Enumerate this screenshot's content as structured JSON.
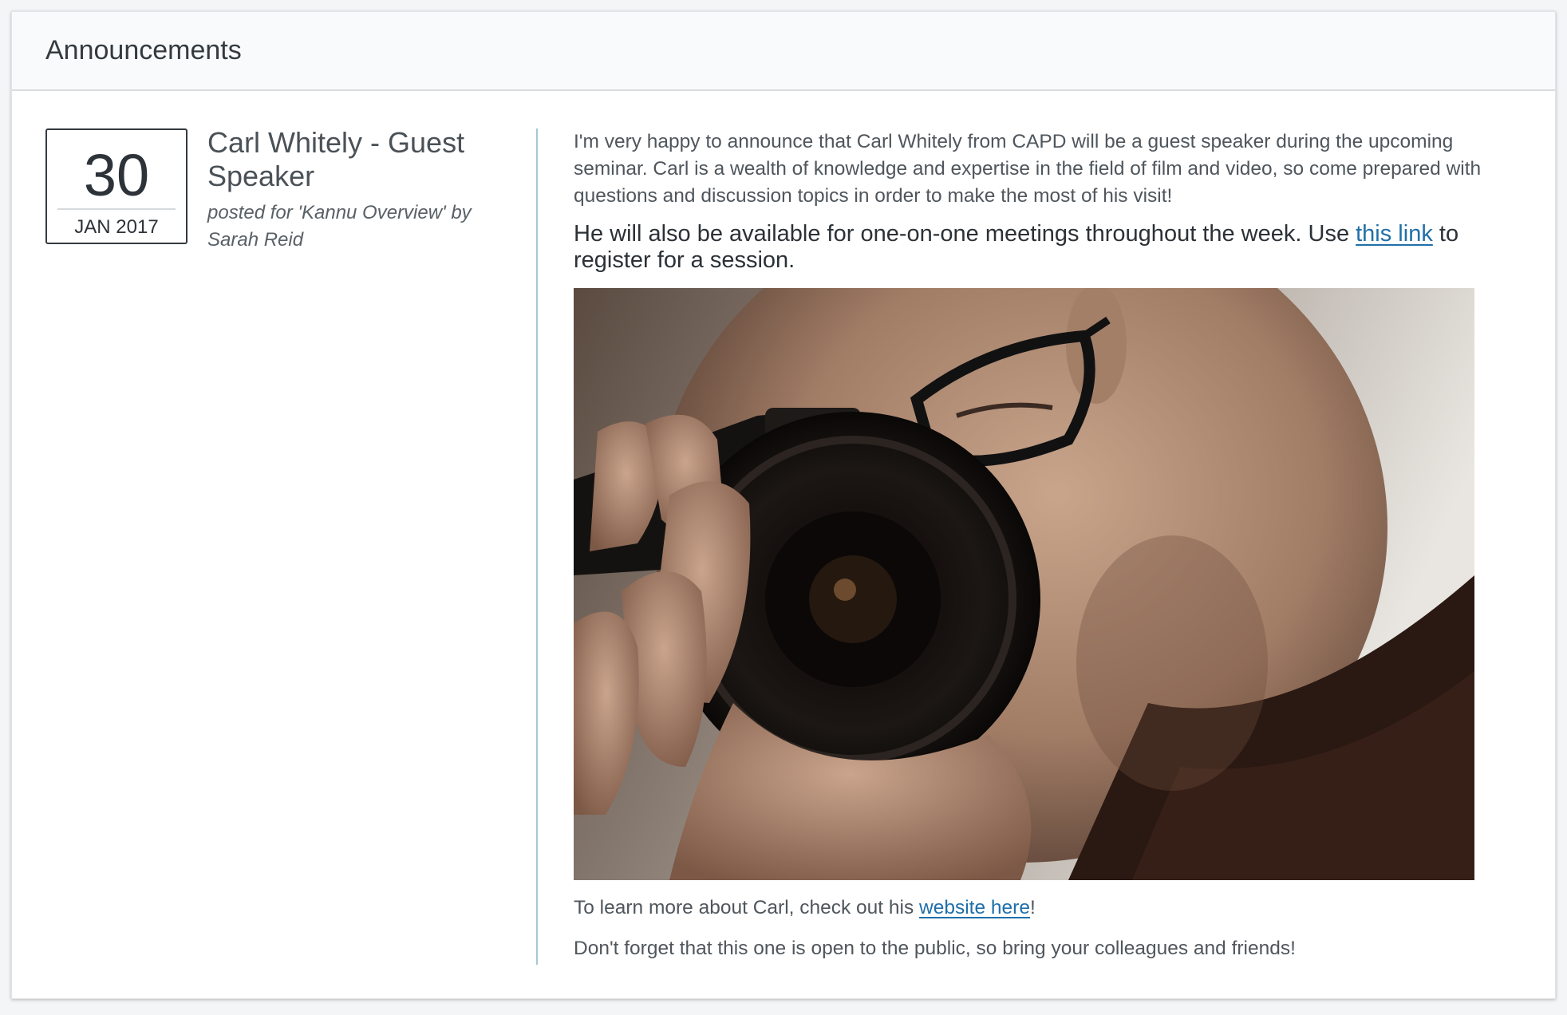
{
  "header": {
    "title": "Announcements"
  },
  "announcement": {
    "date": {
      "day": "30",
      "month_year": "JAN 2017"
    },
    "title": "Carl Whitely - Guest Speaker",
    "posted_for": "posted for 'Kannu Overview' by Sarah Reid",
    "paragraph1": "I'm very happy to announce that Carl Whitely from CAPD will be a guest speaker during the upcoming seminar. Carl is a wealth of knowledge and expertise in the field of film and video, so come prepared with questions and discussion topics in order to make the most of his visit!",
    "paragraph2": {
      "before_link": "He will also be available for one-on-one meetings throughout the week. Use ",
      "link_text": "this link",
      "after_link": " to register for a session."
    },
    "photo_alt": "Photographer holding a camera to his eye",
    "paragraph3": {
      "before_link": "To learn more about Carl, check out his ",
      "link_text": "website here",
      "after_link": "!"
    },
    "paragraph4": "Don't forget that this one is open to the public, so bring your colleagues and friends!"
  },
  "colors": {
    "link": "#1f6fa8",
    "divider": "#a7c6d6",
    "header_bg": "#f9fafb"
  }
}
